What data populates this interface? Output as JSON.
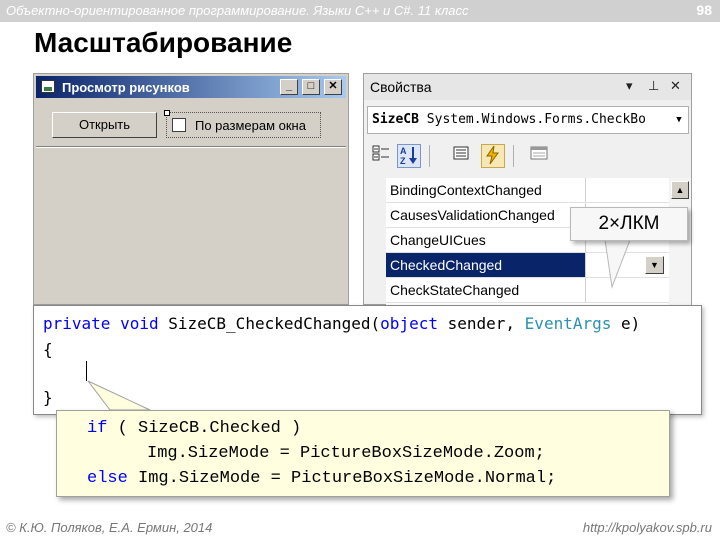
{
  "header": {
    "course": "Объектно-ориентированное программирование. Языки C++ и C#. 11 класс",
    "page_number": "98"
  },
  "slide_title": "Масштабирование",
  "form_window": {
    "title": "Просмотр рисунков",
    "minimize": "_",
    "maximize": "□",
    "close": "✕",
    "open_button": "Открыть",
    "checkbox_label": "По размерам окна"
  },
  "properties_panel": {
    "title": "Свойства",
    "pin": "⊥",
    "close": "✕",
    "dropdown_arrow": "▾",
    "selector_name": "SizeCB",
    "selector_type": "System.Windows.Forms.CheckBo",
    "events": [
      "BindingContextChanged",
      "CausesValidationChanged",
      "ChangeUICues",
      "CheckedChanged",
      "CheckStateChanged"
    ],
    "selected_event": "CheckedChanged",
    "icons": [
      "categorized-icon",
      "alphabetical-icon",
      "properties-icon",
      "events-icon",
      "property-pages-icon"
    ]
  },
  "callout": {
    "text": "2×ЛКМ"
  },
  "code_editor": {
    "line1": {
      "kw1": "private",
      "kw2": "void",
      "name": "Size",
      "name2": "CB_CheckedChanged(",
      "kw3": "object",
      "rest1": " sender, ",
      "type": "EventArgs",
      "rest2": " e)"
    },
    "open_brace": "{",
    "close_brace": "}"
  },
  "overlay_code": {
    "l1_kw": "if",
    "l1_rest": " ( Size",
    "l1_rest2": "CB.Checked )",
    "l2": "Img.SizeMode = PictureBoxSizeMode.Zoom;",
    "l3_kw": "else",
    "l3_rest": " Img.SizeMode = PictureBoxSizeMode.Normal;"
  },
  "footer": {
    "left": "© К.Ю. Поляков, Е.А. Ермин, 2014",
    "right": "http://kpolyakov.spb.ru"
  }
}
